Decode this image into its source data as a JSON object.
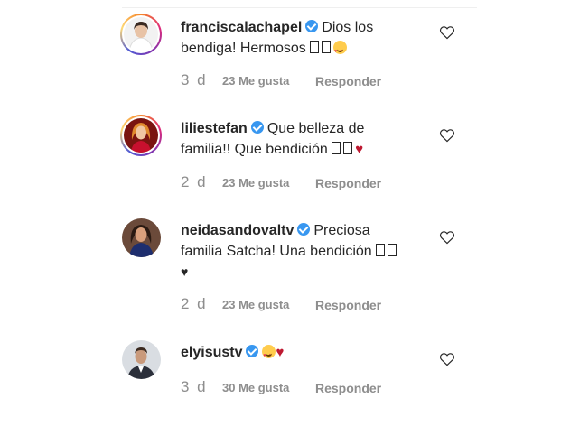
{
  "comments": [
    {
      "username": "franciscalachapel",
      "verified": true,
      "text_line1": "Dios los",
      "text_line2": "bendiga! Hermosos",
      "time": "3 d",
      "likes": "23 Me gusta",
      "reply": "Responder",
      "avatar": "avatar-woman-white-top"
    },
    {
      "username": "liliestefan",
      "verified": true,
      "text_line1": "Que belleza de",
      "text_line2": "familia!! Que bendición",
      "time": "2 d",
      "likes": "23 Me gusta",
      "reply": "Responder",
      "avatar": "avatar-woman-red-hair"
    },
    {
      "username": "neidasandovaltv",
      "verified": true,
      "text_line1": "Preciosa",
      "text_line2": "familia Satcha! Una bendición",
      "text_line3": "♥",
      "time": "2 d",
      "likes": "23 Me gusta",
      "reply": "Responder",
      "avatar": "avatar-woman-dark-hair"
    },
    {
      "username": "elyisustv",
      "verified": true,
      "text_line1": "",
      "time": "3 d",
      "likes": "30 Me gusta",
      "reply": "Responder",
      "avatar": "avatar-man-suit"
    }
  ],
  "colors": {
    "text": "#262626",
    "muted": "#8e8e8e",
    "verified": "#3897f0",
    "heart": "#be1931"
  }
}
